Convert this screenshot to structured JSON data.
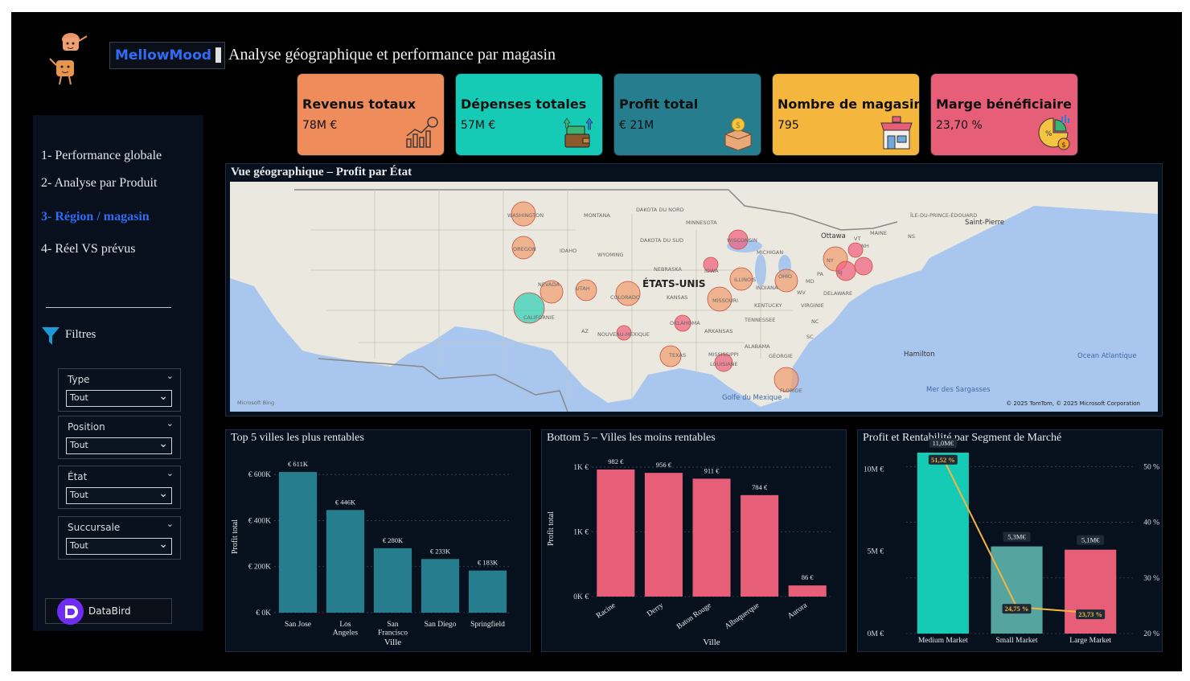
{
  "header": {
    "brand": "MellowMood",
    "title": "Analyse géographique et performance par magasin"
  },
  "sidebar": {
    "nav": [
      {
        "label": "1- Performance globale",
        "active": false
      },
      {
        "label": "2- Analyse par Produit",
        "active": false
      },
      {
        "label": "3- Région / magasin",
        "active": true
      },
      {
        "label": "4- Réel VS prévus",
        "active": false
      }
    ],
    "filters_label": "Filtres",
    "slicers": [
      {
        "title": "Type",
        "value": "Tout"
      },
      {
        "title": "Position",
        "value": "Tout"
      },
      {
        "title": "État",
        "value": "Tout"
      },
      {
        "title": "Succursale",
        "value": "Tout"
      }
    ],
    "databird": "DataBird"
  },
  "kpis": [
    {
      "title": "Revenus totaux",
      "value": "78M €",
      "color": "#ef8c5c",
      "icon": "revenue-chart-icon"
    },
    {
      "title": "Dépenses totales",
      "value": "57M €",
      "color": "#16cbb6",
      "icon": "wallet-icon"
    },
    {
      "title": "Profit total",
      "value": "€ 21M",
      "color": "#257d8d",
      "icon": "coin-box-icon"
    },
    {
      "title": "Nombre de magasin",
      "value": "795",
      "color": "#f5b63e",
      "icon": "store-icon"
    },
    {
      "title": "Marge bénéficiaire",
      "value": "23,70 %",
      "color": "#e75e79",
      "icon": "pie-dollar-icon"
    }
  ],
  "map": {
    "title": "Vue géographique – Profit par État",
    "country_label": "ÉTATS-UNIS",
    "labels": [
      "WASHINGTON",
      "MONTANA",
      "DAKOTA DU NORD",
      "MINNESOTA",
      "DAKOTA DU SUD",
      "WISCONSIN",
      "MICHIGAN",
      "OREGON",
      "IDAHO",
      "WYOMING",
      "NEBRASKA",
      "IOWA",
      "ILLINOIS",
      "INDIANA",
      "OHIO",
      "NEVADA",
      "UTAH",
      "COLORADO",
      "KANSAS",
      "MISSOURI",
      "KENTUCKY",
      "VIRGINIE",
      "WV",
      "DELAWARE",
      "MD",
      "NJ",
      "NY",
      "PA",
      "CALIFORNIE",
      "AZ",
      "NOUVEAU-MEXIQUE",
      "OKLAHOMA",
      "ARKANSAS",
      "TENNESSEE",
      "NC",
      "SC",
      "ALABAMA",
      "GÉORGIE",
      "MISSISSIPPI",
      "TEXAS",
      "LOUISIANE",
      "FLORIDE",
      "Ottawa",
      "MAINE",
      "VT",
      "NH",
      "NS",
      "ÎLE-DU-PRINCE-ÉDOUARD",
      "Saint-Pierre",
      "Hamilton",
      "Ocean Atlantique",
      "Mer des Sargasses",
      "Golfe du Mexique"
    ],
    "attribution": "© 2025 TomTom, © 2025 Microsoft Corporation",
    "bing": "Microsoft Bing"
  },
  "top5": {
    "title": "Top 5 villes les plus rentables",
    "chart_data": {
      "type": "bar",
      "categories": [
        "San Jose",
        "Los Angeles",
        "San Francisco",
        "San Diego",
        "Springfield"
      ],
      "values": [
        611,
        446,
        280,
        233,
        183
      ],
      "data_labels": [
        "€ 611K",
        "€ 446K",
        "€ 280K",
        "€ 233K",
        "€ 183K"
      ],
      "xlabel": "Ville",
      "ylabel": "Profit total",
      "ytick_labels": [
        "€ 0K",
        "€ 200K",
        "€ 400K",
        "€ 600K"
      ],
      "yticks": [
        0,
        200,
        400,
        600
      ],
      "ylim": [
        0,
        660
      ],
      "color": "#257d8d"
    }
  },
  "bottom5": {
    "title": "Bottom 5 – Villes les moins rentables",
    "chart_data": {
      "type": "bar",
      "categories": [
        "Racine",
        "Derry",
        "Baton Rouge",
        "Albuquerque",
        "Aurora"
      ],
      "values": [
        982,
        956,
        911,
        784,
        86
      ],
      "data_labels": [
        "982 €",
        "956 €",
        "911 €",
        "784 €",
        "86 €"
      ],
      "xlabel": "Ville",
      "ylabel": "Profit total",
      "ytick_labels": [
        "0K €",
        "1K €",
        "1K €"
      ],
      "yticks": [
        0,
        500,
        1000
      ],
      "ylim": [
        0,
        1050
      ],
      "color": "#e75e79"
    }
  },
  "segment": {
    "title": "Profit et Rentabilité par Segment de Marché",
    "chart_data": {
      "type": "bar",
      "categories": [
        "Medium Market",
        "Small Market",
        "Large Market"
      ],
      "series": [
        {
          "name": "Profit",
          "values": [
            11.0,
            5.3,
            5.1
          ],
          "labels": [
            "11,0M€",
            "5,3M€",
            "5,1M€"
          ]
        },
        {
          "name": "Marge",
          "values": [
            51.52,
            24.75,
            23.73
          ],
          "labels": [
            "51,52 %",
            "24,75 %",
            "23,73 %"
          ]
        }
      ],
      "bar_colors": [
        "#16cbb6",
        "#55a4a0",
        "#e75e79"
      ],
      "line_color": "#f5b63e",
      "y_left_ticks": [
        0,
        5,
        10
      ],
      "y_left_labels": [
        "0M €",
        "5M €",
        "10M €"
      ],
      "y_left_lim": [
        0,
        11
      ],
      "y_right_ticks": [
        20,
        30,
        40,
        50
      ],
      "y_right_labels": [
        "20 %",
        "30 %",
        "40 %",
        "50 %"
      ],
      "y_right_lim": [
        20,
        52.5
      ]
    }
  }
}
